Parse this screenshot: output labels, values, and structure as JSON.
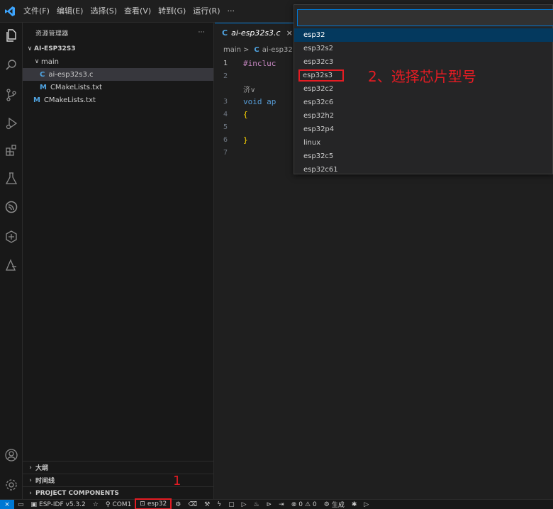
{
  "menubar": {
    "items": [
      "文件(F)",
      "编辑(E)",
      "选择(S)",
      "查看(V)",
      "转到(G)",
      "运行(R)",
      "···"
    ]
  },
  "sidebar": {
    "title": "资源管理器",
    "more": "···",
    "project": "AI-ESP32S3",
    "tree": [
      {
        "label": "main",
        "type": "folder",
        "indent": 1
      },
      {
        "label": "ai-esp32s3.c",
        "type": "c",
        "indent": 2,
        "selected": true
      },
      {
        "label": "CMakeLists.txt",
        "type": "m",
        "indent": 2
      },
      {
        "label": "CMakeLists.txt",
        "type": "m",
        "indent": 1
      }
    ],
    "sections": [
      "大纲",
      "时间线",
      "PROJECT COMPONENTS"
    ]
  },
  "editor": {
    "tab": {
      "icon": "C",
      "title": "ai-esp32s3.c",
      "close": "×"
    },
    "breadcrumb": {
      "folder": "main",
      "sep": ">",
      "icon": "C",
      "file": "ai-esp32"
    },
    "lines": [
      {
        "n": "1",
        "text": "#incluc"
      },
      {
        "n": "2",
        "text": ""
      },
      {
        "n": "",
        "text": "济∨"
      },
      {
        "n": "3",
        "text": "void ap"
      },
      {
        "n": "4",
        "text": "{"
      },
      {
        "n": "5",
        "text": ""
      },
      {
        "n": "6",
        "text": "}"
      },
      {
        "n": "7",
        "text": ""
      }
    ]
  },
  "quickpick": {
    "input_value": "",
    "items": [
      "esp32",
      "esp32s2",
      "esp32c3",
      "esp32s3",
      "esp32c2",
      "esp32c6",
      "esp32h2",
      "esp32p4",
      "linux",
      "esp32c5",
      "esp32c61"
    ],
    "active_index": 0,
    "highlighted_index": 3
  },
  "annotations": {
    "step2": "2、选择芯片型号",
    "step1": "1"
  },
  "statusbar": {
    "idf": "ESP-IDF v5.3.2",
    "port": "COM1",
    "target": "esp32",
    "problems_errors": "0",
    "problems_warnings": "0",
    "build": "生成"
  },
  "colors": {
    "accent": "#0078d4",
    "annotation": "#e51c23",
    "list_active": "#04395e"
  }
}
